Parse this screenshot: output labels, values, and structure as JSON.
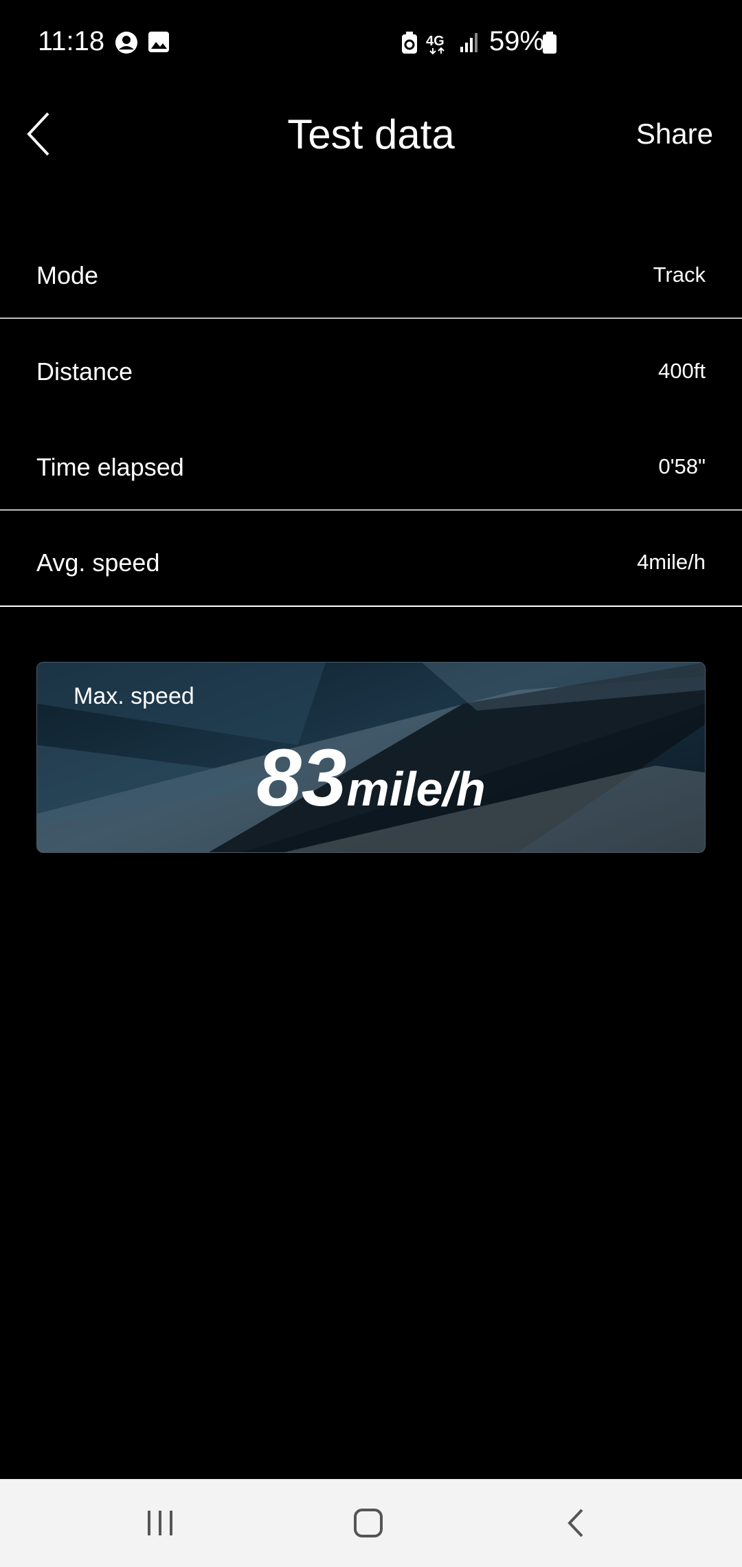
{
  "status": {
    "time": "11:18",
    "battery": "59%"
  },
  "appbar": {
    "title": "Test data",
    "share_label": "Share"
  },
  "rows": [
    {
      "label": "Mode",
      "value": "Track"
    },
    {
      "label": "Distance",
      "value": "400ft"
    },
    {
      "label": "Time elapsed",
      "value": "0'58\""
    },
    {
      "label": "Avg. speed",
      "value": "4mile/h"
    }
  ],
  "max_speed": {
    "label": "Max. speed",
    "value": "83",
    "unit": "mile/h"
  },
  "icons": {
    "status": [
      "account-circle-icon",
      "image-icon",
      "battery-saver-icon",
      "4g-icon",
      "signal-icon",
      "battery-icon"
    ],
    "nav": [
      "recents-icon",
      "home-icon",
      "back-icon"
    ]
  }
}
